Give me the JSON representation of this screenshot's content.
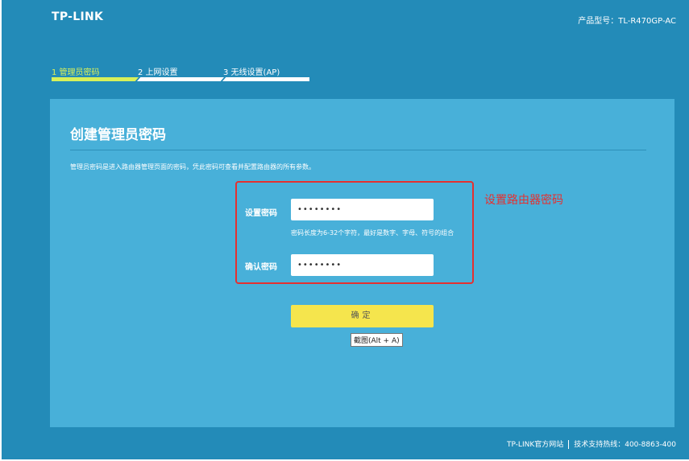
{
  "header": {
    "logo": "TP-LINK",
    "model": "产品型号：TL-R470GP-AC"
  },
  "steps": [
    {
      "label": "1 管理员密码",
      "active": true
    },
    {
      "label": "2 上网设置",
      "active": false
    },
    {
      "label": "3 无线设置(AP)",
      "active": false
    }
  ],
  "panel": {
    "title": "创建管理员密码",
    "description": "管理员密码是进入路由器管理页面的密码，凭此密码可查看并配置路由器的所有参数。",
    "password_label": "设置密码",
    "password_value": "••••••••",
    "hint": "密码长度为6-32个字符，最好是数字、字母、符号的组合",
    "confirm_label": "确认密码",
    "confirm_value": "••••••••",
    "submit_label": "确定",
    "tooltip": "截图(Alt + A)"
  },
  "annotation": {
    "text": "设置路由器密码",
    "color": "#e53030"
  },
  "footer": {
    "official_site": "TP-LINK官方网站",
    "hotline": "技术支持热线：400-8863-400"
  },
  "colors": {
    "background": "#238bb8",
    "panel": "#48b0d9",
    "active_step": "#d7f05a",
    "button": "#f5e54d"
  }
}
